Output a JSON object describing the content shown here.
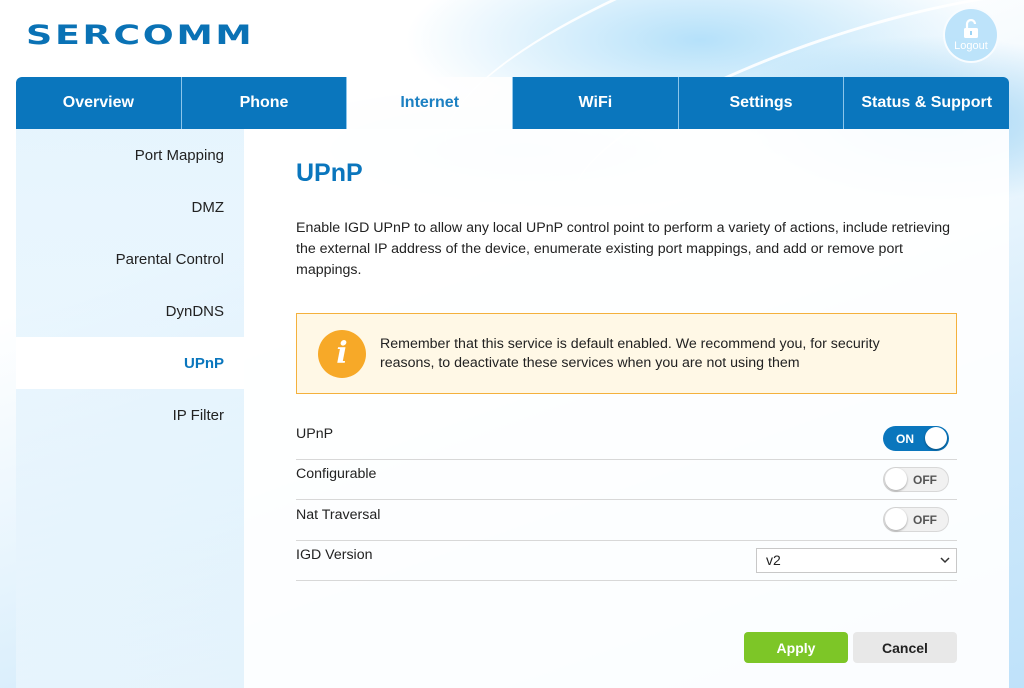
{
  "brand": {
    "logo_text": "SERCOMM",
    "accent": "#0a76bd"
  },
  "header": {
    "logout_label": "Logout",
    "logout_icon": "unlock-icon"
  },
  "tabs": [
    {
      "label": "Overview",
      "active": false
    },
    {
      "label": "Phone",
      "active": false
    },
    {
      "label": "Internet",
      "active": true
    },
    {
      "label": "WiFi",
      "active": false
    },
    {
      "label": "Settings",
      "active": false
    },
    {
      "label": "Status & Support",
      "active": false
    }
  ],
  "sidebar": {
    "items": [
      {
        "label": "Port Mapping",
        "active": false
      },
      {
        "label": "DMZ",
        "active": false
      },
      {
        "label": "Parental Control",
        "active": false
      },
      {
        "label": "DynDNS",
        "active": false
      },
      {
        "label": "UPnP",
        "active": true
      },
      {
        "label": "IP Filter",
        "active": false
      }
    ]
  },
  "main": {
    "title": "UPnP",
    "description": "Enable IGD UPnP to allow any local UPnP control point to perform a variety of actions, include retrieving the external IP address of the device, enumerate existing port mappings, and add or remove port mappings.",
    "notice": {
      "icon": "info-icon",
      "icon_glyph": "i",
      "text": "Remember that this service is default enabled. We recommend you, for security reasons, to deactivate these services when you are not using them",
      "color": "#f7a928"
    },
    "settings": {
      "upnp": {
        "label": "UPnP",
        "state": "ON"
      },
      "configurable": {
        "label": "Configurable",
        "state": "OFF"
      },
      "nat_traversal": {
        "label": "Nat Traversal",
        "state": "OFF"
      },
      "igd_version": {
        "label": "IGD Version",
        "value": "v2"
      }
    },
    "buttons": {
      "apply": "Apply",
      "cancel": "Cancel"
    },
    "colors": {
      "apply": "#7dc627",
      "cancel": "#e8e8e8"
    }
  }
}
